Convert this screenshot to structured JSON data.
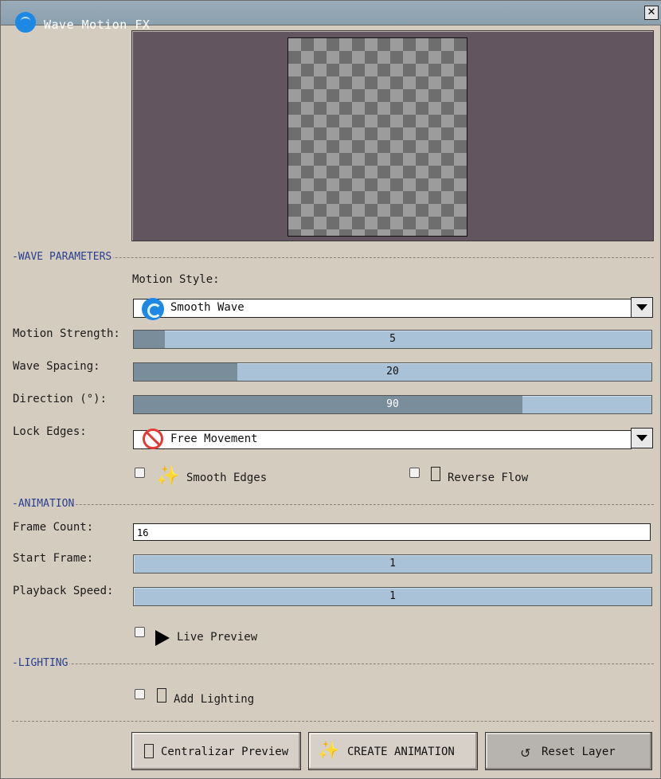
{
  "window": {
    "title": "Wave Motion FX",
    "icon": "wave-icon",
    "close_glyph": "✕"
  },
  "sections": {
    "wave": "-WAVE PARAMETERS",
    "animation": "-ANIMATION",
    "lighting": "-LIGHTING"
  },
  "wave": {
    "motion_style_label": "Motion Style:",
    "motion_style_value": "Smooth Wave",
    "motion_strength_label": "Motion Strength:",
    "motion_strength_value": "5",
    "motion_strength_fill": 0.06,
    "wave_spacing_label": "Wave Spacing:",
    "wave_spacing_value": "20",
    "wave_spacing_fill": 0.2,
    "direction_label": "Direction (°):",
    "direction_value": "90",
    "direction_fill": 0.75,
    "lock_edges_label": "Lock Edges:",
    "lock_edges_value": "Free Movement",
    "smooth_edges_label": "Smooth Edges",
    "smooth_edges_checked": false,
    "reverse_flow_label": "Reverse Flow",
    "reverse_flow_checked": false
  },
  "animation": {
    "frame_count_label": "Frame Count:",
    "frame_count_value": "16",
    "start_frame_label": "Start Frame:",
    "start_frame_value": "1",
    "playback_speed_label": "Playback Speed:",
    "playback_speed_value": "1",
    "live_preview_label": "Live Preview",
    "live_preview_checked": false
  },
  "lighting": {
    "add_lighting_label": "Add Lighting",
    "add_lighting_checked": false
  },
  "buttons": {
    "center_preview": "Centralizar Preview",
    "create_animation": "CREATE ANIMATION",
    "reset_layer": "Reset Layer"
  },
  "colors": {
    "preview_bg": "#635560",
    "slider_track": "#a9c2d8",
    "slider_fill": "#7a8d9b",
    "section_label": "#2a3f8f"
  }
}
